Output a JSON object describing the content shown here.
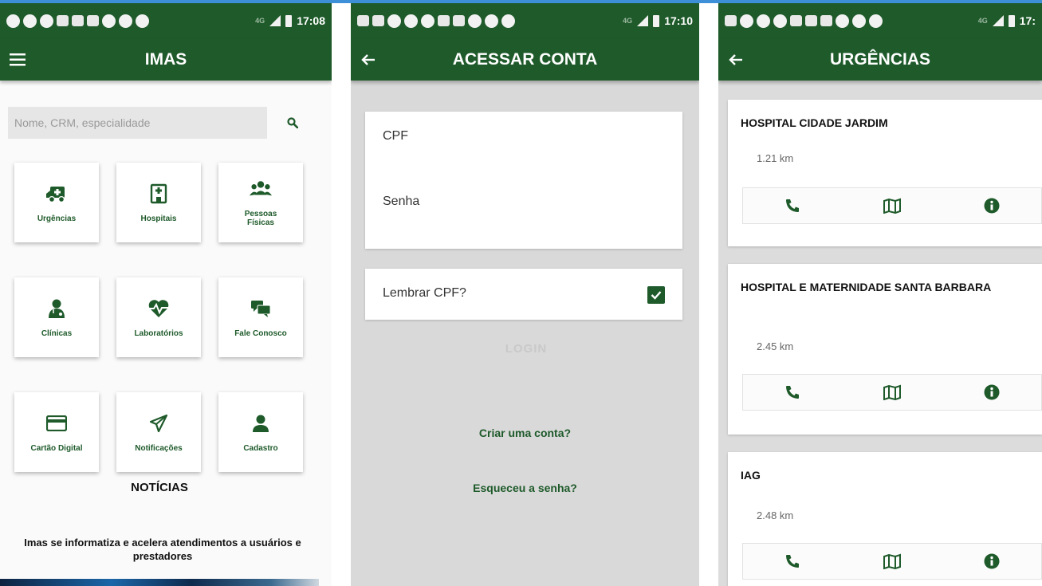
{
  "colors": {
    "primary": "#1e5a2a",
    "accent_line": "#3d8fd8"
  },
  "screens": [
    {
      "status": {
        "time": "17:08",
        "network": "4G"
      },
      "appbar": {
        "title": "IMAS",
        "nav_icon": "menu-icon"
      },
      "search": {
        "placeholder": "Nome, CRM, especialidade",
        "value": ""
      },
      "tiles": [
        {
          "label": "Urgências",
          "icon": "ambulance-icon"
        },
        {
          "label": "Hospitais",
          "icon": "hospital-icon"
        },
        {
          "label": "Pessoas\nFísicas",
          "icon": "people-icon"
        },
        {
          "label": "Clínicas",
          "icon": "doctor-icon"
        },
        {
          "label": "Laboratórios",
          "icon": "heartbeat-icon"
        },
        {
          "label": "Fale Conosco",
          "icon": "chat-icon"
        },
        {
          "label": "Cartão Digital",
          "icon": "credit-card-icon"
        },
        {
          "label": "Notificações",
          "icon": "paper-plane-icon"
        },
        {
          "label": "Cadastro",
          "icon": "user-icon"
        }
      ],
      "news": {
        "heading": "NOTÍCIAS",
        "headline": "Imas se informatiza e acelera atendimentos a usuários e prestadores"
      }
    },
    {
      "status": {
        "time": "17:10",
        "network": "4G"
      },
      "appbar": {
        "title": "ACESSAR CONTA",
        "nav_icon": "back-arrow-icon"
      },
      "cpf_label": "CPF",
      "password_label": "Senha",
      "remember_label": "Lembrar CPF?",
      "remember_checked": true,
      "login_label": "LOGIN",
      "create_account": "Criar uma conta?",
      "forgot_password": "Esqueceu a senha?"
    },
    {
      "status": {
        "time": "17:",
        "network": "4G"
      },
      "appbar": {
        "title": "URGÊNCIAS",
        "nav_icon": "back-arrow-icon"
      },
      "hospitals": [
        {
          "name": "HOSPITAL CIDADE JARDIM",
          "distance": "1.21 km"
        },
        {
          "name": "HOSPITAL E MATERNIDADE SANTA BARBARA",
          "distance": "2.45 km"
        },
        {
          "name": "IAG",
          "distance": "2.48 km"
        }
      ],
      "action_icons": [
        "phone-icon",
        "map-icon",
        "info-icon"
      ]
    }
  ]
}
